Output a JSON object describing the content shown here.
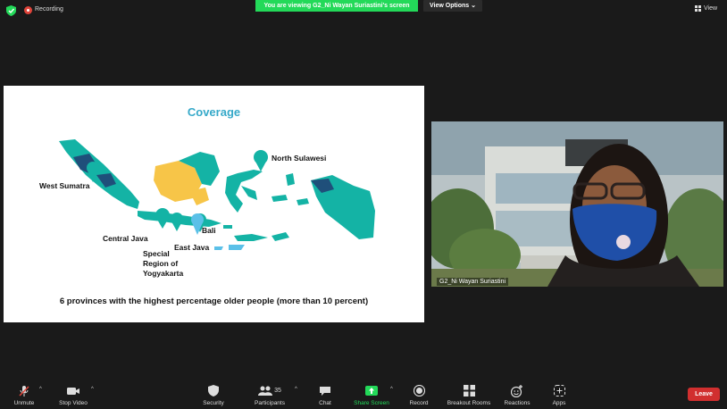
{
  "topbar": {
    "recording_label": "Recording",
    "viewing_banner": "You are viewing G2_Ni Wayan Suriastini's screen",
    "view_options_label": "View Options ⌄",
    "view_label": "View"
  },
  "slide": {
    "title": "Coverage",
    "labels": {
      "west_sumatra": "West Sumatra",
      "north_sulawesi": "North Sulawesi",
      "central_java": "Central Java",
      "east_java": "East Java",
      "bali": "Bali",
      "yogyakarta_1": "Special",
      "yogyakarta_2": "Region of",
      "yogyakarta_3": "Yogyakarta"
    },
    "caption": "6 provinces with the highest percentage older people (more than 10 percent)",
    "colors": {
      "teal": "#14b3a5",
      "navy": "#1f4f7a",
      "yellow": "#f7c548",
      "pin": "#5bc0e8"
    }
  },
  "participant": {
    "name": "G2_Ni Wayan Suriastini"
  },
  "toolbar": {
    "unmute": "Unmute",
    "stop_video": "Stop Video",
    "security": "Security",
    "participants": "Participants",
    "participants_count": "35",
    "chat": "Chat",
    "share_screen": "Share Screen",
    "record": "Record",
    "breakout_rooms": "Breakout Rooms",
    "reactions": "Reactions",
    "apps": "Apps",
    "leave": "Leave"
  }
}
